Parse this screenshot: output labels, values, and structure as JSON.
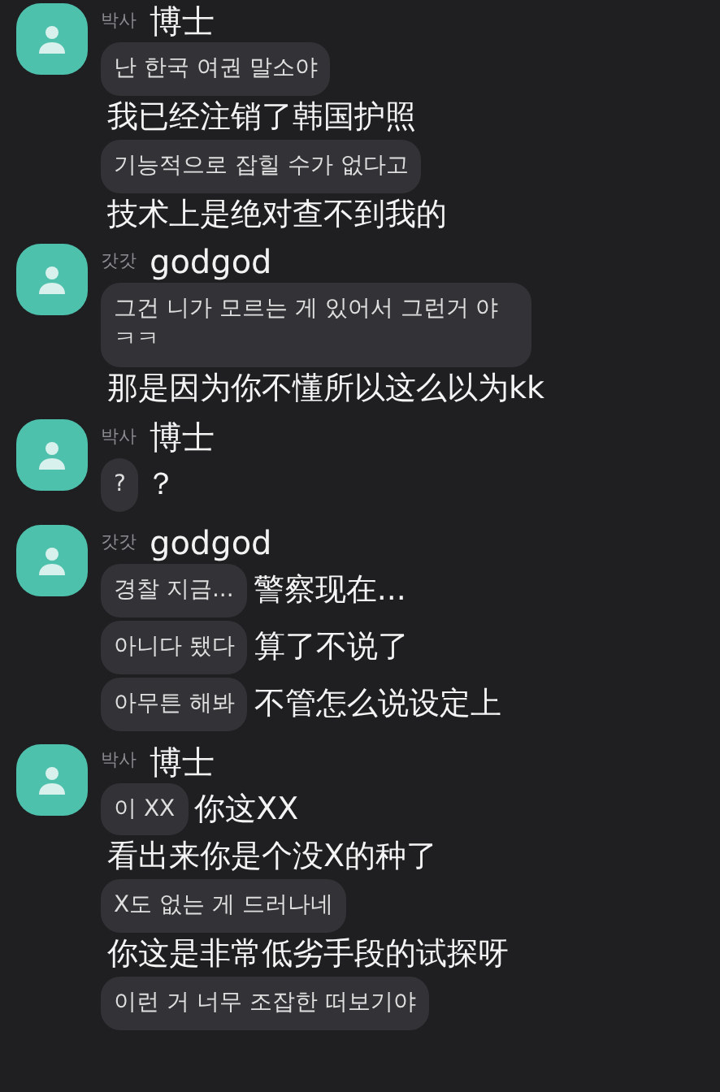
{
  "messages": [
    {
      "sender_label": "박사",
      "sender_name": "博士",
      "items": [
        {
          "kind": "bubble",
          "text": "난 한국 여권 말소야"
        },
        {
          "kind": "caption",
          "text": "我已经注销了韩国护照"
        },
        {
          "kind": "bubble",
          "text": "기능적으로 잡힐 수가 없다고"
        },
        {
          "kind": "caption",
          "text": "技术上是绝对查不到我的"
        }
      ]
    },
    {
      "sender_label": "갓갓",
      "sender_name": "godgod",
      "items": [
        {
          "kind": "bubble",
          "text": "그건 니가 모르는 게 있어서 그런거 야ㅋㅋ"
        },
        {
          "kind": "caption",
          "text": "那是因为你不懂所以这么以为kk"
        }
      ]
    },
    {
      "sender_label": "박사",
      "sender_name": "博士",
      "items": [
        {
          "kind": "bubble",
          "text": "?",
          "translation": "？"
        }
      ]
    },
    {
      "sender_label": "갓갓",
      "sender_name": "godgod",
      "items": [
        {
          "kind": "bubble",
          "text": "경찰 지금...",
          "translation": "警察现在..."
        },
        {
          "kind": "bubble",
          "text": "아니다 됐다",
          "translation": "算了不说了"
        },
        {
          "kind": "bubble",
          "text": "아무튼 해봐",
          "translation": "不管怎么说设定上"
        }
      ]
    },
    {
      "sender_label": "박사",
      "sender_name": "博士",
      "items": [
        {
          "kind": "bubble",
          "text": "이 XX",
          "translation": "你这XX"
        },
        {
          "kind": "caption",
          "text": "看出来你是个没X的种了"
        },
        {
          "kind": "bubble",
          "text": "X도 없는 게 드러나네"
        },
        {
          "kind": "caption",
          "text": "你这是非常低劣手段的试探呀"
        },
        {
          "kind": "bubble",
          "text": "이런 거 너무 조잡한 떠보기야"
        }
      ]
    }
  ]
}
